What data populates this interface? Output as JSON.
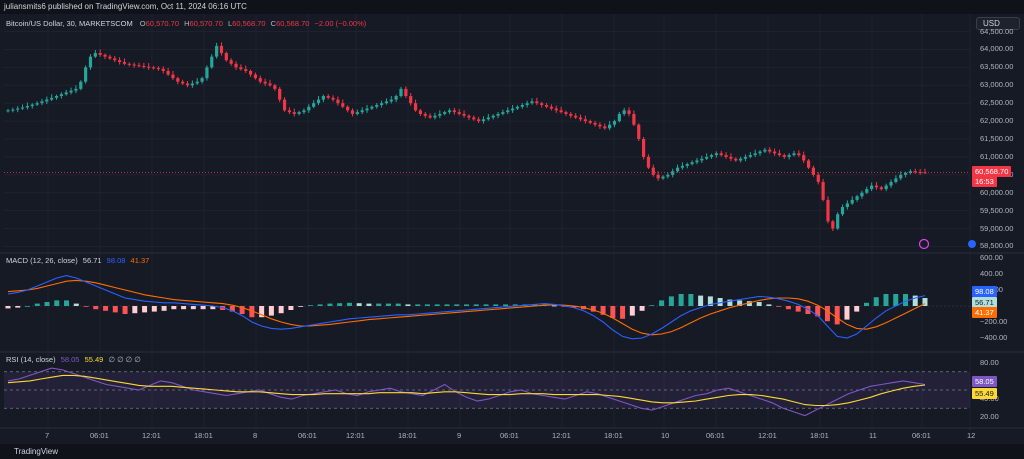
{
  "header": {
    "publisher": "juliansmits6 published on TradingView.com, Oct 11, 2024 06:16 UTC"
  },
  "currency_button": "USD",
  "price_legend": {
    "symbol": "Bitcoin/US Dollar, 30, MARKETSCOM",
    "o_label": "O",
    "o": "60,570.70",
    "h_label": "H",
    "h": "60,570.70",
    "l_label": "L",
    "l": "60,568.70",
    "c_label": "C",
    "c": "60,568.70",
    "chg": "−2.00 (−0.00%)"
  },
  "macd_legend": {
    "name": "MACD (12, 26, close)",
    "v1": "56.71",
    "v2": "98.08",
    "v3": "41.37"
  },
  "rsi_legend": {
    "name": "RSI (14, close)",
    "v1": "58.05",
    "v2": "55.49",
    "extra": "∅ ∅ ∅ ∅"
  },
  "price_axis": [
    "64,500.00",
    "64,000.00",
    "63,500.00",
    "63,000.00",
    "62,500.00",
    "62,000.00",
    "61,500.00",
    "61,000.00",
    "60,500.00",
    "60,000.00",
    "59,500.00",
    "59,000.00",
    "58,500.00"
  ],
  "macd_axis": [
    "600.00",
    "400.00",
    "200.00",
    "−200.00",
    "−400.00"
  ],
  "rsi_axis": [
    "80.00",
    "40.00",
    "20.00"
  ],
  "price_tag": {
    "value": "60,568.70",
    "countdown": "16:53"
  },
  "macd_tags": [
    "98.08",
    "56.71",
    "41.37"
  ],
  "rsi_tags": [
    "58.05",
    "55.49"
  ],
  "time_axis": [
    "7",
    "06:01",
    "12:01",
    "18:01",
    "8",
    "06:01",
    "12:01",
    "18:01",
    "9",
    "06:01",
    "12:01",
    "18:01",
    "10",
    "06:01",
    "12:01",
    "18:01",
    "11",
    "06:01",
    "12"
  ],
  "footer": {
    "brand": "TradingView"
  },
  "colors": {
    "up": "#26a69a",
    "down": "#f23645",
    "macd": "#2962ff",
    "signal": "#ff6d00",
    "rsi": "#7e57c2",
    "rsi_ma": "#fdd835"
  },
  "chart_data": [
    {
      "type": "candlestick",
      "title": "Bitcoin/US Dollar, 30, MARKETSCOM",
      "ylim": [
        58400,
        64600
      ],
      "x_labels": [
        "7",
        "06:01",
        "12:01",
        "18:01",
        "8",
        "06:01",
        "12:01",
        "18:01",
        "9",
        "06:01",
        "12:01",
        "18:01",
        "10",
        "06:01",
        "12:01",
        "18:01",
        "11",
        "06:01",
        "12"
      ],
      "close": [
        62300,
        62320,
        62350,
        62380,
        62420,
        62460,
        62500,
        62550,
        62600,
        62650,
        62700,
        62750,
        62800,
        62850,
        62900,
        63100,
        63500,
        63800,
        63900,
        63850,
        63800,
        63750,
        63700,
        63650,
        63600,
        63580,
        63560,
        63540,
        63520,
        63500,
        63480,
        63460,
        63400,
        63300,
        63200,
        63100,
        63050,
        63000,
        63050,
        63100,
        63200,
        63500,
        63800,
        64100,
        63900,
        63700,
        63600,
        63500,
        63450,
        63400,
        63300,
        63200,
        63100,
        63050,
        63000,
        62900,
        62600,
        62300,
        62250,
        62200,
        62250,
        62300,
        62400,
        62500,
        62600,
        62700,
        62650,
        62600,
        62500,
        62400,
        62300,
        62200,
        62250,
        62300,
        62350,
        62400,
        62450,
        62500,
        62550,
        62600,
        62700,
        62900,
        62700,
        62500,
        62300,
        62200,
        62150,
        62100,
        62150,
        62200,
        62250,
        62300,
        62250,
        62200,
        62150,
        62100,
        62050,
        62000,
        62050,
        62100,
        62150,
        62200,
        62250,
        62300,
        62350,
        62400,
        62450,
        62500,
        62550,
        62500,
        62450,
        62400,
        62350,
        62300,
        62250,
        62200,
        62150,
        62100,
        62050,
        62000,
        61950,
        61900,
        61850,
        61800,
        61900,
        62000,
        62200,
        62300,
        62200,
        61900,
        61500,
        61000,
        60700,
        60500,
        60400,
        60450,
        60500,
        60600,
        60700,
        60750,
        60800,
        60850,
        60900,
        60950,
        61000,
        61050,
        61100,
        61050,
        61000,
        60950,
        60900,
        60950,
        61000,
        61050,
        61100,
        61150,
        61200,
        61150,
        61100,
        61050,
        61000,
        61050,
        61100,
        61050,
        60900,
        60700,
        60500,
        60300,
        59800,
        59200,
        59000,
        59400,
        59600,
        59700,
        59800,
        59900,
        60000,
        60100,
        60200,
        60150,
        60100,
        60200,
        60300,
        60400,
        60500,
        60550,
        60600,
        60580,
        60570,
        60568.7
      ]
    },
    {
      "type": "histogram_line",
      "title": "MACD (12, 26, close)",
      "ylim": [
        -500,
        600
      ],
      "series": [
        {
          "name": "MACD",
          "values": [
            150,
            170,
            200,
            250,
            300,
            350,
            380,
            350,
            300,
            250,
            200,
            150,
            100,
            80,
            60,
            50,
            40,
            40,
            30,
            20,
            10,
            0,
            -20,
            -60,
            -120,
            -200,
            -250,
            -280,
            -290,
            -280,
            -260,
            -240,
            -220,
            -200,
            -180,
            -160,
            -150,
            -140,
            -130,
            -120,
            -110,
            -110,
            -100,
            -90,
            -80,
            -70,
            -60,
            -50,
            -40,
            -30,
            -20,
            -10,
            0,
            10,
            20,
            30,
            20,
            0,
            -20,
            -60,
            -120,
            -200,
            -300,
            -380,
            -410,
            -400,
            -350,
            -280,
            -200,
            -120,
            -60,
            -20,
            20,
            40,
            60,
            80,
            100,
            120,
            110,
            90,
            60,
            20,
            -40,
            -120,
            -250,
            -380,
            -400,
            -350,
            -250,
            -150,
            -60,
            0,
            60,
            100,
            130
          ]
        },
        {
          "name": "Signal",
          "values": [
            180,
            190,
            200,
            220,
            250,
            280,
            310,
            320,
            310,
            290,
            260,
            230,
            200,
            170,
            140,
            120,
            100,
            80,
            70,
            60,
            50,
            40,
            30,
            10,
            -20,
            -60,
            -110,
            -160,
            -200,
            -230,
            -250,
            -250,
            -240,
            -230,
            -215,
            -200,
            -185,
            -170,
            -160,
            -150,
            -140,
            -130,
            -120,
            -110,
            -100,
            -90,
            -80,
            -70,
            -60,
            -50,
            -40,
            -30,
            -20,
            -10,
            0,
            10,
            15,
            10,
            0,
            -20,
            -50,
            -90,
            -150,
            -220,
            -290,
            -340,
            -360,
            -350,
            -320,
            -270,
            -210,
            -150,
            -100,
            -60,
            -20,
            10,
            40,
            70,
            90,
            100,
            100,
            90,
            60,
            10,
            -60,
            -150,
            -230,
            -280,
            -290,
            -260,
            -210,
            -150,
            -90,
            -30,
            30
          ]
        },
        {
          "name": "Histogram",
          "values": [
            -30,
            -20,
            0,
            30,
            50,
            70,
            70,
            30,
            -10,
            -40,
            -60,
            -80,
            -100,
            -90,
            -80,
            -70,
            -60,
            -40,
            -40,
            -40,
            -40,
            -40,
            -50,
            -70,
            -100,
            -140,
            -140,
            -120,
            -90,
            -50,
            -10,
            10,
            20,
            30,
            35,
            40,
            35,
            30,
            30,
            30,
            30,
            20,
            20,
            20,
            20,
            20,
            20,
            20,
            20,
            20,
            20,
            20,
            20,
            20,
            20,
            20,
            5,
            -10,
            -20,
            -40,
            -70,
            -110,
            -150,
            -160,
            -120,
            -60,
            10,
            70,
            120,
            150,
            150,
            130,
            120,
            100,
            80,
            70,
            60,
            50,
            20,
            -10,
            -40,
            -70,
            -100,
            -130,
            -190,
            -230,
            -170,
            -70,
            40,
            110,
            150,
            150,
            150,
            130,
            100
          ]
        }
      ]
    },
    {
      "type": "line",
      "title": "RSI (14, close)",
      "ylim": [
        15,
        85
      ],
      "series": [
        {
          "name": "RSI",
          "values": [
            60,
            62,
            66,
            70,
            74,
            72,
            68,
            64,
            60,
            56,
            54,
            52,
            50,
            55,
            60,
            58,
            54,
            50,
            48,
            46,
            44,
            46,
            48,
            50,
            46,
            42,
            40,
            44,
            46,
            48,
            50,
            46,
            44,
            48,
            50,
            52,
            48,
            46,
            44,
            50,
            56,
            48,
            42,
            38,
            40,
            44,
            48,
            50,
            46,
            44,
            42,
            40,
            44,
            48,
            46,
            42,
            38,
            34,
            30,
            28,
            32,
            36,
            40,
            44,
            46,
            50,
            52,
            48,
            44,
            40,
            36,
            30,
            26,
            22,
            28,
            34,
            40,
            46,
            50,
            54,
            56,
            58,
            60,
            58,
            56
          ]
        },
        {
          "name": "RSI-based MA",
          "values": [
            58,
            59,
            60,
            62,
            64,
            66,
            66,
            65,
            63,
            61,
            59,
            57,
            55,
            54,
            54,
            54,
            53,
            52,
            51,
            50,
            49,
            48,
            48,
            48,
            47,
            46,
            45,
            45,
            45,
            46,
            46,
            46,
            46,
            46,
            47,
            47,
            47,
            47,
            46,
            47,
            48,
            48,
            47,
            46,
            45,
            45,
            45,
            46,
            46,
            46,
            45,
            45,
            45,
            45,
            45,
            44,
            43,
            41,
            39,
            37,
            36,
            36,
            37,
            38,
            40,
            42,
            44,
            45,
            45,
            44,
            42,
            40,
            37,
            34,
            33,
            33,
            34,
            36,
            39,
            42,
            46,
            49,
            52,
            54,
            55.49
          ]
        }
      ]
    }
  ]
}
